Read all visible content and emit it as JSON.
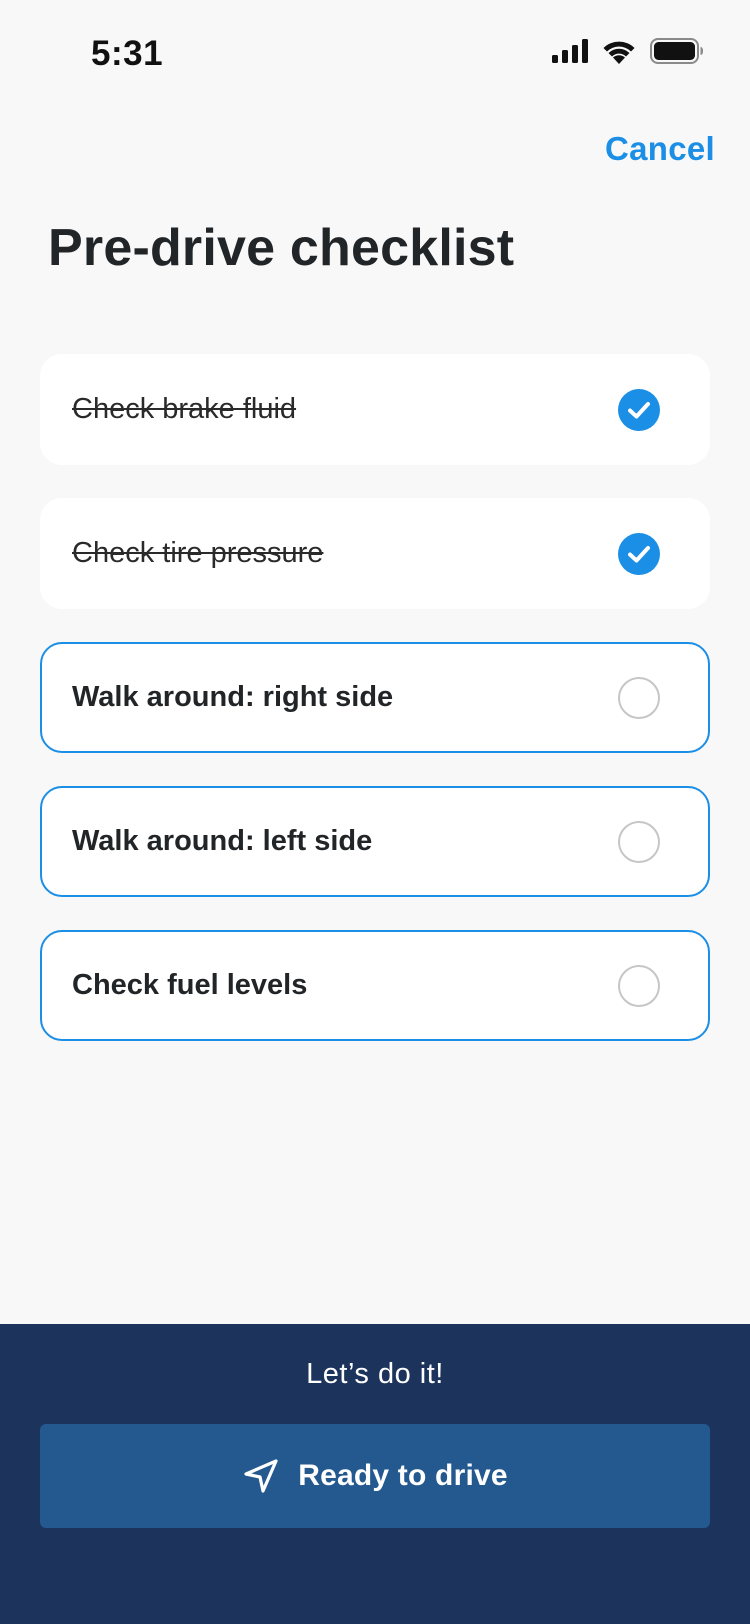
{
  "status_bar": {
    "time": "5:31"
  },
  "header": {
    "cancel_label": "Cancel",
    "title": "Pre-drive checklist"
  },
  "checklist": {
    "items": [
      {
        "label": "Check brake fluid",
        "done": true
      },
      {
        "label": "Check tire pressure",
        "done": true
      },
      {
        "label": "Walk around: right side",
        "done": false
      },
      {
        "label": "Walk around: left side",
        "done": false
      },
      {
        "label": "Check fuel levels",
        "done": false
      }
    ]
  },
  "footer": {
    "motto": "Let’s do it!",
    "button_label": "Ready to drive",
    "button_icon": "navigation-arrow-icon"
  },
  "colors": {
    "accent": "#1b8ee5",
    "panel": "#1c335c",
    "button": "#245990"
  }
}
